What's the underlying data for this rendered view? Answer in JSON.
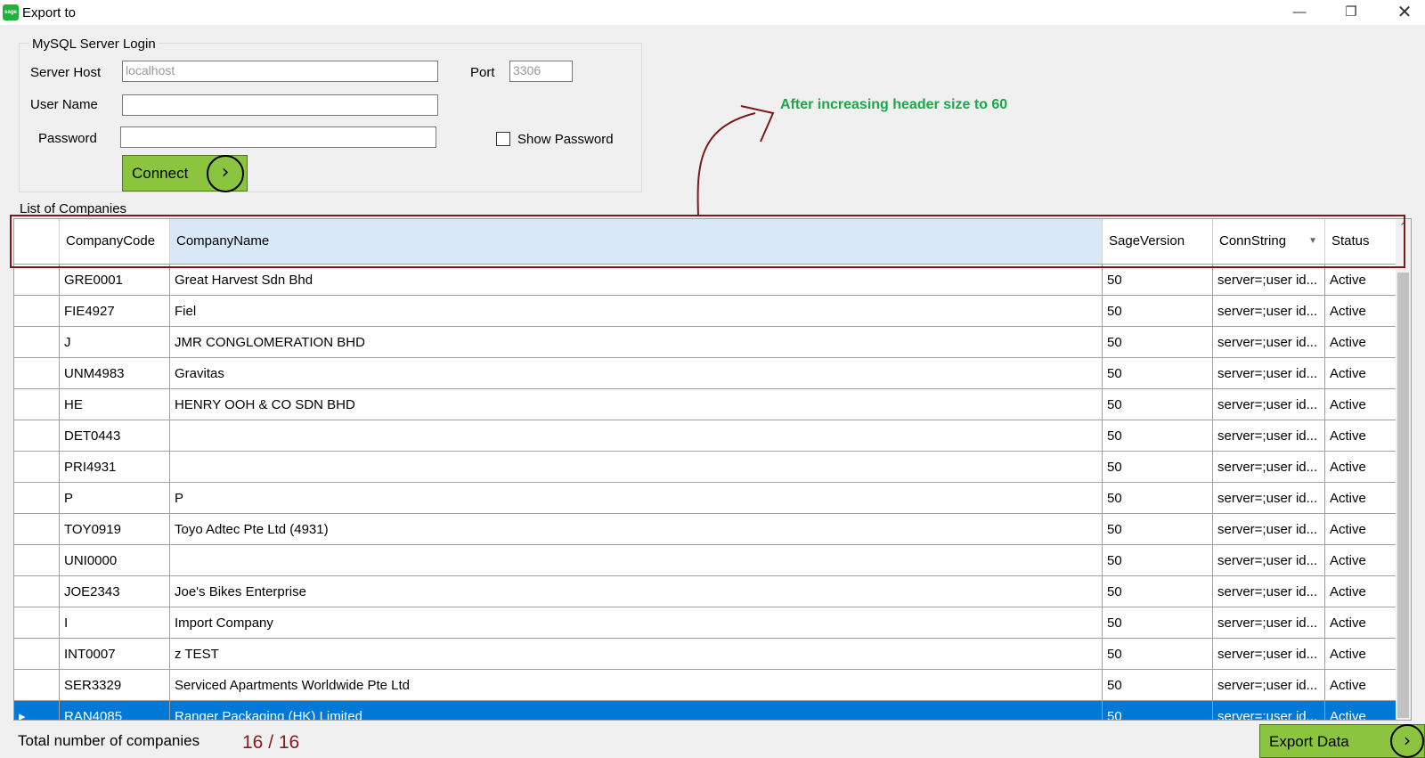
{
  "window": {
    "title": "Export to",
    "app_icon": "sage"
  },
  "login": {
    "legend": "MySQL Server Login",
    "server_host_label": "Server Host",
    "server_host_value": "localhost",
    "port_label": "Port",
    "port_value": "3306",
    "username_label": "User Name",
    "username_value": "",
    "password_label": "Password",
    "password_value": "",
    "show_password_label": "Show Password",
    "connect_label": "Connect"
  },
  "annotation": "After increasing header size to 60",
  "list": {
    "label": "List of Companies",
    "columns": [
      "CompanyCode",
      "CompanyName",
      "SageVersion",
      "ConnString",
      "Status"
    ],
    "rows": [
      {
        "code": "GRE0001",
        "name": "Great Harvest Sdn Bhd",
        "version": "50",
        "conn": "server=;user id...",
        "status": "Active"
      },
      {
        "code": "FIE4927",
        "name": "Fiel",
        "version": "50",
        "conn": "server=;user id...",
        "status": "Active"
      },
      {
        "code": "J",
        "name": "JMR CONGLOMERATION BHD",
        "version": "50",
        "conn": "server=;user id...",
        "status": "Active"
      },
      {
        "code": "UNM4983",
        "name": "Gravitas",
        "version": "50",
        "conn": "server=;user id...",
        "status": "Active"
      },
      {
        "code": "HE",
        "name": "HENRY OOH & CO SDN BHD",
        "version": "50",
        "conn": "server=;user id...",
        "status": "Active"
      },
      {
        "code": "DET0443",
        "name": "",
        "version": "50",
        "conn": "server=;user id...",
        "status": "Active"
      },
      {
        "code": "PRI4931",
        "name": "",
        "version": "50",
        "conn": "server=;user id...",
        "status": "Active"
      },
      {
        "code": "P",
        "name": "P",
        "version": "50",
        "conn": "server=;user id...",
        "status": "Active"
      },
      {
        "code": "TOY0919",
        "name": "Toyo Adtec Pte Ltd (4931)",
        "version": "50",
        "conn": "server=;user id...",
        "status": "Active"
      },
      {
        "code": "UNI0000",
        "name": "",
        "version": "50",
        "conn": "server=;user id...",
        "status": "Active"
      },
      {
        "code": "JOE2343",
        "name": "Joe's Bikes Enterprise",
        "version": "50",
        "conn": "server=;user id...",
        "status": "Active"
      },
      {
        "code": "I",
        "name": "Import Company",
        "version": "50",
        "conn": "server=;user id...",
        "status": "Active"
      },
      {
        "code": "INT0007",
        "name": "z TEST",
        "version": "50",
        "conn": "server=;user id...",
        "status": "Active"
      },
      {
        "code": "SER3329",
        "name": "Serviced Apartments Worldwide Pte Ltd",
        "version": "50",
        "conn": "server=;user id...",
        "status": "Active"
      },
      {
        "code": "RAN4085",
        "name": "Ranger Packaging (HK) Limited",
        "version": "50",
        "conn": "server=;user id...",
        "status": "Active"
      }
    ]
  },
  "footer": {
    "total_label": "Total number of companies",
    "count": "16 / 16",
    "export_label": "Export Data"
  }
}
